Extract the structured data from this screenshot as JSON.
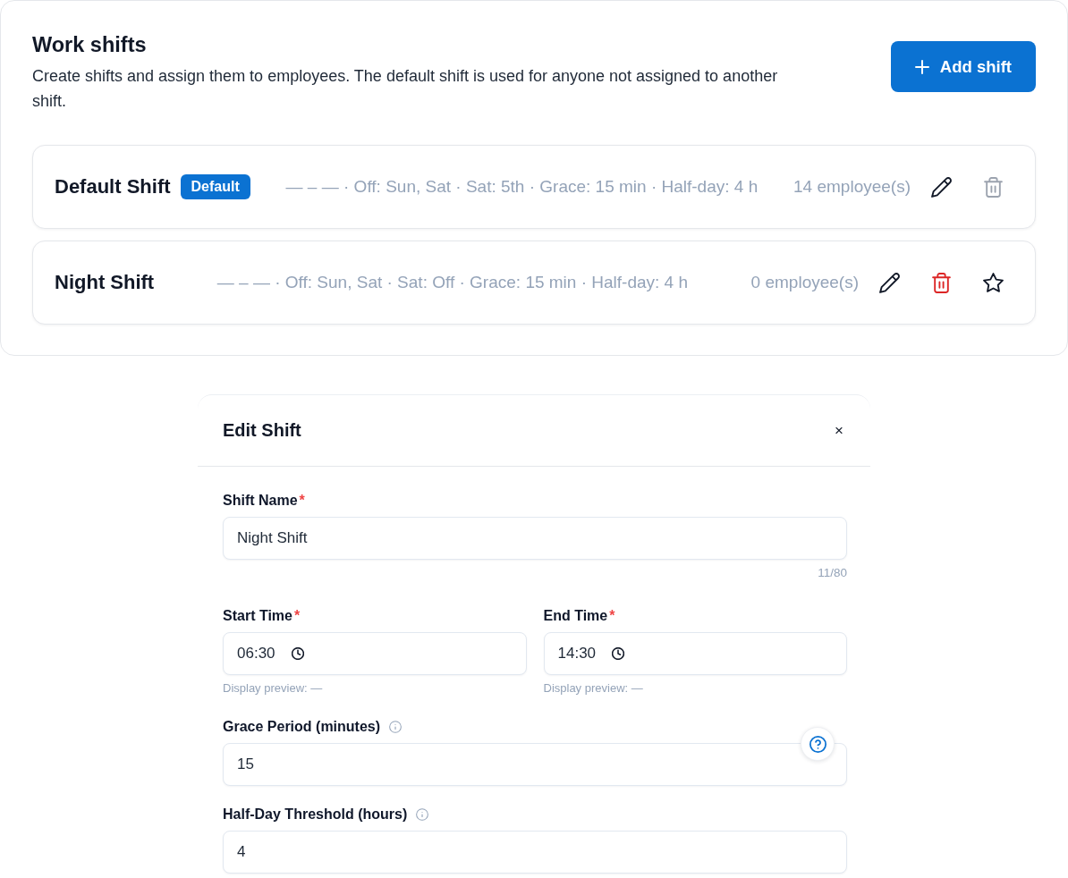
{
  "header": {
    "title": "Work shifts",
    "description": "Create shifts and assign them to employees. The default shift is used for anyone not assigned to another shift.",
    "add_button": "Add shift"
  },
  "shifts": [
    {
      "name": "Default Shift",
      "badge": "Default",
      "default": true,
      "summary": "— – — · Off: Sun, Sat · Sat: 5th · Grace: 15 min · Half-day: 4 h",
      "employees": "14 employee(s)"
    },
    {
      "name": "Night Shift",
      "default": false,
      "summary": "— – — · Off: Sun, Sat · Sat: Off · Grace: 15 min · Half-day: 4 h",
      "employees": "0 employee(s)"
    }
  ],
  "editor": {
    "title": "Edit Shift",
    "close": "×",
    "required_mark": "*",
    "name_field": {
      "label": "Shift Name",
      "required": true,
      "info": false,
      "value": "Night Shift",
      "counter": "11/80"
    },
    "time_fields": [
      {
        "label": "Start Time",
        "required": true,
        "info": false,
        "value": "06:30",
        "hint": "Display preview: —"
      },
      {
        "label": "End Time",
        "required": true,
        "info": false,
        "value": "14:30",
        "hint": "Display preview: —"
      }
    ],
    "number_fields": [
      {
        "label": "Grace Period (minutes)",
        "required": false,
        "info": true,
        "value": "15",
        "help": true
      },
      {
        "label": "Half-Day Threshold (hours)",
        "required": false,
        "info": true,
        "value": "4",
        "help": false
      }
    ]
  }
}
